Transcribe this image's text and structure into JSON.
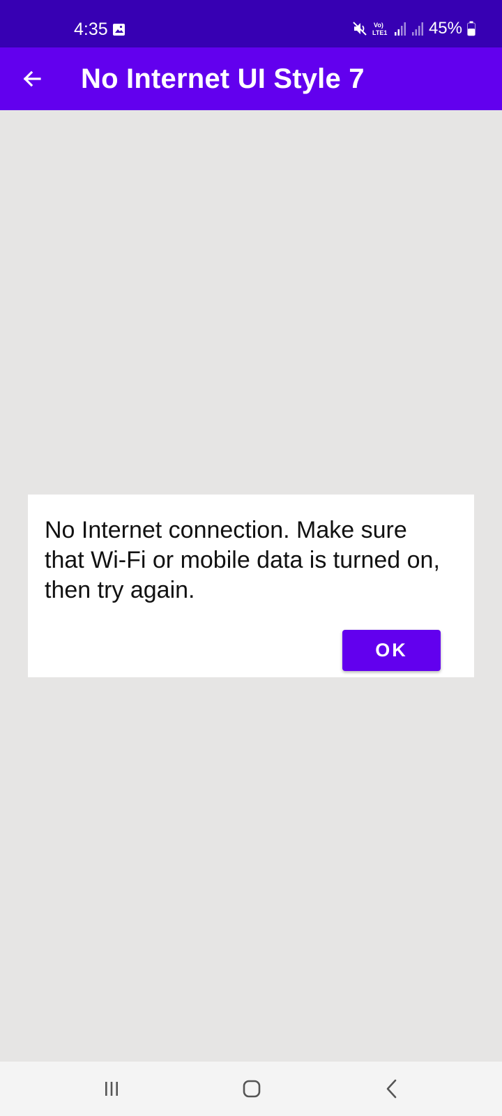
{
  "status_bar": {
    "time": "4:35",
    "battery_percent": "45%",
    "icons": [
      "gallery-icon",
      "mute-icon",
      "volte-icon",
      "signal-icon",
      "signal-icon",
      "battery-icon"
    ]
  },
  "app_bar": {
    "title": "No Internet UI Style 7",
    "back_icon": "arrow-left-icon",
    "color": "#6200ee"
  },
  "dialog": {
    "message": "No Internet connection. Make sure that Wi-Fi or mobile data is turned on, then try again.",
    "ok_label": "OK"
  },
  "nav_bar": {
    "items": [
      "recents-icon",
      "home-icon",
      "back-icon"
    ]
  },
  "colors": {
    "status_bar": "#3700b3",
    "primary": "#6200ee",
    "background": "#e6e5e4"
  }
}
